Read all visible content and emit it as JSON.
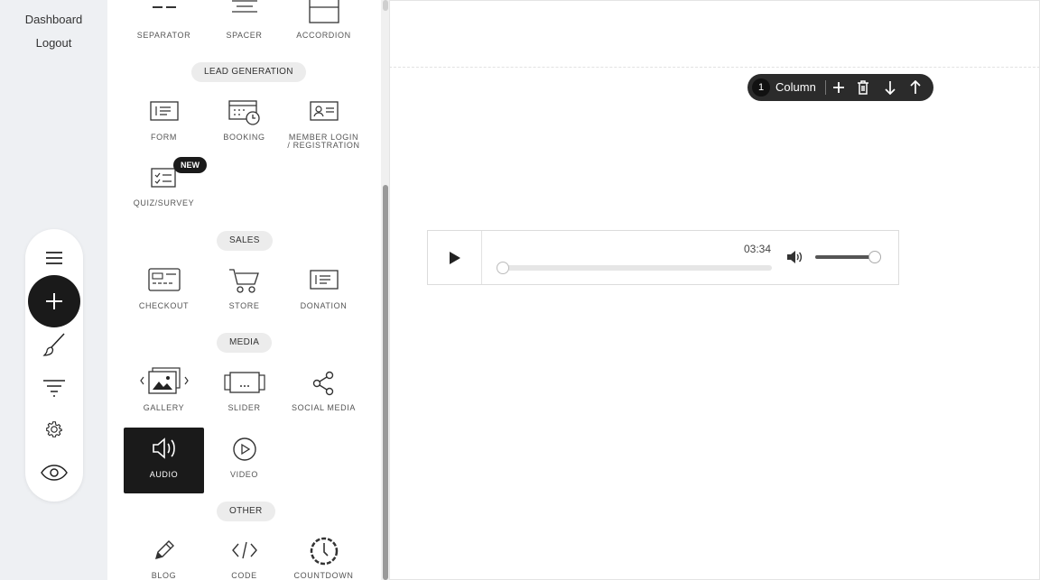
{
  "nav": {
    "dashboard": "Dashboard",
    "logout": "Logout"
  },
  "toolbar": {
    "icons": [
      "menu-icon",
      "plus-icon",
      "brush-icon",
      "filter-icon",
      "gear-icon",
      "eye-icon"
    ]
  },
  "panel": {
    "layout_row": [
      {
        "label": "SEPARATOR",
        "icon": "separator-icon"
      },
      {
        "label": "SPACER",
        "icon": "spacer-icon"
      },
      {
        "label": "ACCORDION",
        "icon": "accordion-icon"
      }
    ],
    "categories": {
      "lead": "LEAD GENERATION",
      "sales": "SALES",
      "media": "MEDIA",
      "other": "OTHER"
    },
    "lead_items": [
      {
        "label": "FORM",
        "icon": "form-icon"
      },
      {
        "label": "BOOKING",
        "icon": "booking-icon"
      },
      {
        "label": "MEMBER LOGIN / REGISTRATION",
        "icon": "member-card-icon"
      },
      {
        "label": "QUIZ/SURVEY",
        "icon": "checklist-icon",
        "badge": "NEW"
      }
    ],
    "sales_items": [
      {
        "label": "CHECKOUT",
        "icon": "credit-card-icon"
      },
      {
        "label": "STORE",
        "icon": "cart-icon"
      },
      {
        "label": "DONATION",
        "icon": "donation-icon"
      }
    ],
    "media_items": [
      {
        "label": "GALLERY",
        "icon": "gallery-icon"
      },
      {
        "label": "SLIDER",
        "icon": "slider-icon"
      },
      {
        "label": "SOCIAL MEDIA",
        "icon": "share-icon"
      },
      {
        "label": "AUDIO",
        "icon": "speaker-icon"
      },
      {
        "label": "VIDEO",
        "icon": "play-circle-icon"
      }
    ],
    "other_items": [
      {
        "label": "BLOG",
        "icon": "pencil-icon"
      },
      {
        "label": "CODE",
        "icon": "code-icon"
      },
      {
        "label": "COUNTDOWN",
        "icon": "countdown-icon"
      }
    ]
  },
  "column_toolbar": {
    "count": "1",
    "label": "Column",
    "icons": [
      "plus-icon",
      "trash-icon",
      "arrow-down-icon",
      "arrow-up-icon"
    ]
  },
  "audio_player": {
    "time": "03:34",
    "progress": 0,
    "volume": 1
  }
}
